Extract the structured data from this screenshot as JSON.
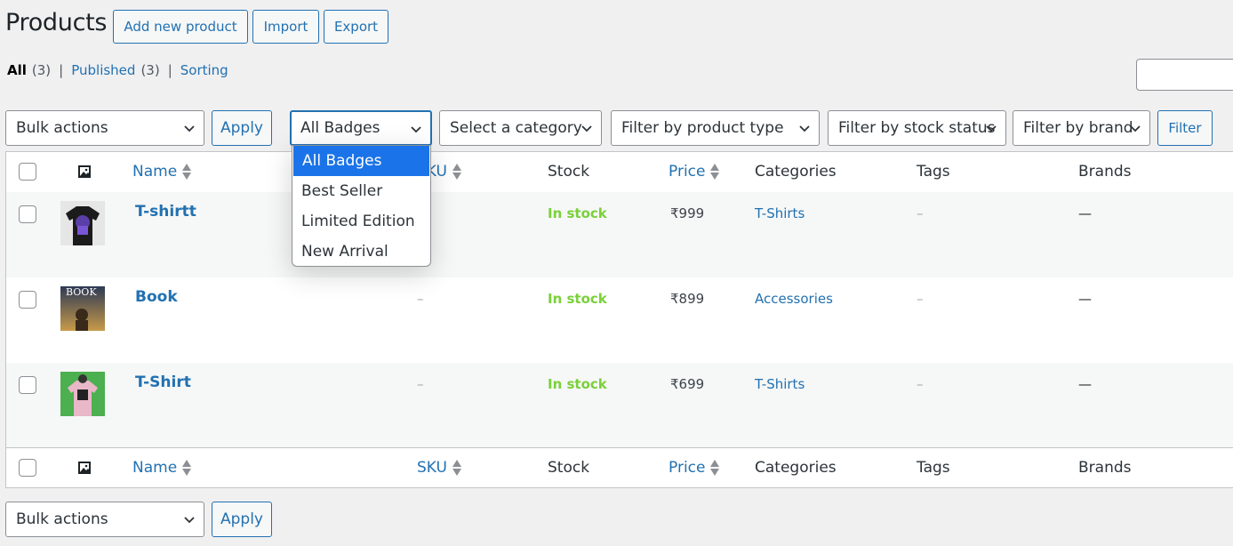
{
  "header": {
    "title": "Products",
    "add_new": "Add new product",
    "import": "Import",
    "export": "Export"
  },
  "views": {
    "all_label": "All",
    "all_count": "(3)",
    "published_label": "Published",
    "published_count": "(3)",
    "sorting_label": "Sorting",
    "separator": "|"
  },
  "filters": {
    "bulk_actions": "Bulk actions",
    "apply": "Apply",
    "badges": "All Badges",
    "category": "Select a category",
    "product_type": "Filter by product type",
    "stock_status": "Filter by stock status",
    "brand": "Filter by brand",
    "filter_button": "Filter"
  },
  "badge_dropdown": {
    "options": [
      "All Badges",
      "Best Seller",
      "Limited Edition",
      "New Arrival"
    ],
    "selected": "All Badges"
  },
  "columns": {
    "name": "Name",
    "sku": "SKU",
    "stock": "Stock",
    "price": "Price",
    "categories": "Categories",
    "tags": "Tags",
    "brands": "Brands"
  },
  "products": [
    {
      "name": "T-shirtt",
      "sku": "–",
      "stock": "In stock",
      "price": "₹999",
      "category": "T-Shirts",
      "tags": "–",
      "brands": "—",
      "thumb_label": ""
    },
    {
      "name": "Book",
      "sku": "–",
      "stock": "In stock",
      "price": "₹899",
      "category": "Accessories",
      "tags": "–",
      "brands": "—",
      "thumb_label": "BOOK"
    },
    {
      "name": "T-Shirt",
      "sku": "–",
      "stock": "In stock",
      "price": "₹699",
      "category": "T-Shirts",
      "tags": "–",
      "brands": "—",
      "thumb_label": ""
    }
  ],
  "footer": {
    "bulk_actions": "Bulk actions",
    "apply": "Apply"
  },
  "colors": {
    "accent": "#2271b1",
    "in_stock": "#7ad03a",
    "dropdown_selected": "#1a73e8"
  }
}
